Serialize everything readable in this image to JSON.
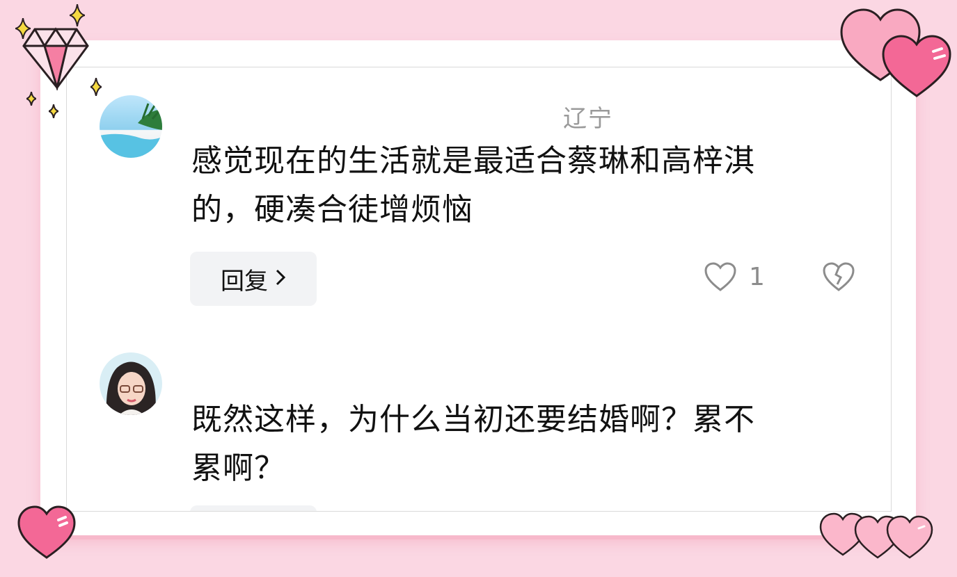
{
  "comments": [
    {
      "location": "辽宁",
      "text_line1": "感觉现在的生活就是最适合蔡琳和高梓淇",
      "text_line2": "的，硬凑合徒增烦恼",
      "reply_label": "回复",
      "like_count": "1"
    },
    {
      "text_line1": "既然这样，为什么当初还要结婚啊？累不",
      "text_line2": "累啊？"
    }
  ],
  "icons": [
    "diamond-icon",
    "sparkle-icon",
    "heart-icon",
    "chevron-right-icon",
    "broken-heart-icon"
  ],
  "colors": {
    "background": "#fbd7e3",
    "heart": "#f26a93",
    "accent_pink": "#f8a8c0"
  }
}
